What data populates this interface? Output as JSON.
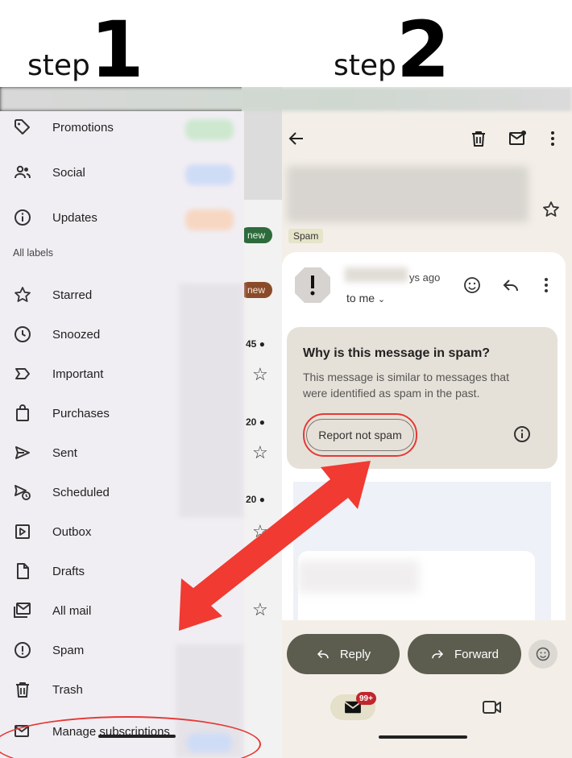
{
  "headings": {
    "step1_word": "step",
    "step1_num": "1",
    "step2_word": "step",
    "step2_num": "2"
  },
  "drawer": {
    "items_top": [
      {
        "label": "Promotions",
        "icon": "tag-icon"
      },
      {
        "label": "Social",
        "icon": "people-icon"
      },
      {
        "label": "Updates",
        "icon": "info-icon"
      }
    ],
    "section_label": "All labels",
    "items": [
      {
        "label": "Starred",
        "icon": "star-icon"
      },
      {
        "label": "Snoozed",
        "icon": "clock-icon"
      },
      {
        "label": "Important",
        "icon": "important-icon"
      },
      {
        "label": "Purchases",
        "icon": "shopping-bag-icon"
      },
      {
        "label": "Sent",
        "icon": "send-icon"
      },
      {
        "label": "Scheduled",
        "icon": "scheduled-send-icon"
      },
      {
        "label": "Outbox",
        "icon": "outbox-icon"
      },
      {
        "label": "Drafts",
        "icon": "draft-icon"
      },
      {
        "label": "All mail",
        "icon": "all-mail-icon"
      },
      {
        "label": "Spam",
        "icon": "spam-icon"
      },
      {
        "label": "Trash",
        "icon": "trash-icon"
      },
      {
        "label": "Manage subscriptions",
        "icon": "manage-subscriptions-icon"
      }
    ]
  },
  "inbox_behind": {
    "badge_new_1": "new",
    "badge_new_2": "new",
    "time_1": "45",
    "time_2": "20",
    "time_3": "20"
  },
  "message": {
    "spam_chip": "Spam",
    "time_ago": "ys ago",
    "to_me": "to me",
    "why_title": "Why is this message in spam?",
    "why_body": "This message is similar to messages that were identified as spam in the past.",
    "report_not_spam": "Report not spam",
    "reply_label": "Reply",
    "forward_label": "Forward",
    "nav_badge": "99+"
  },
  "colors": {
    "highlight_red": "#e53935",
    "arrow_red": "#f03a32",
    "pill_button": "#5c5d4f"
  }
}
